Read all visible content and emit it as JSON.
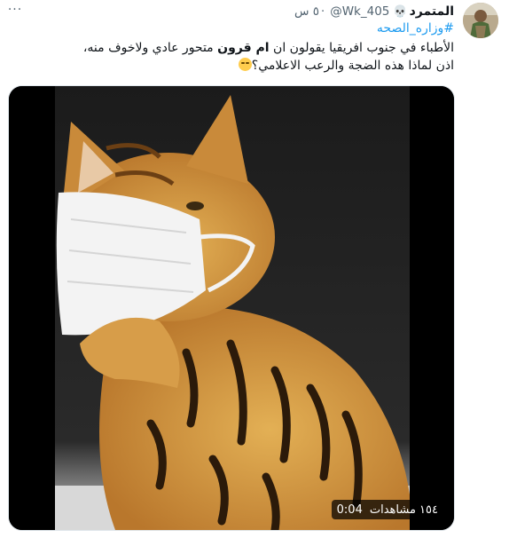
{
  "author": {
    "display_name": "المتمرد",
    "name_emoji": "💀",
    "handle": "@Wk_405",
    "separator": "·",
    "time": "٥ س"
  },
  "menu_label": "···",
  "hashtag": "#وزاره_الصحه",
  "body": {
    "line1_before": "الأطباء في جنوب افريقيا يقولون ان ",
    "line1_bold": "ام قرون",
    "line1_after": " متحور عادي ولاخوف منه،",
    "line2": "اذن لماذا هذه الضجة والرعب الاعلامي؟"
  },
  "video": {
    "duration": "0:04",
    "views": "١٥٤ مشاهدات"
  },
  "colors": {
    "link": "#1d9bf0",
    "secondary_text": "#536471"
  }
}
